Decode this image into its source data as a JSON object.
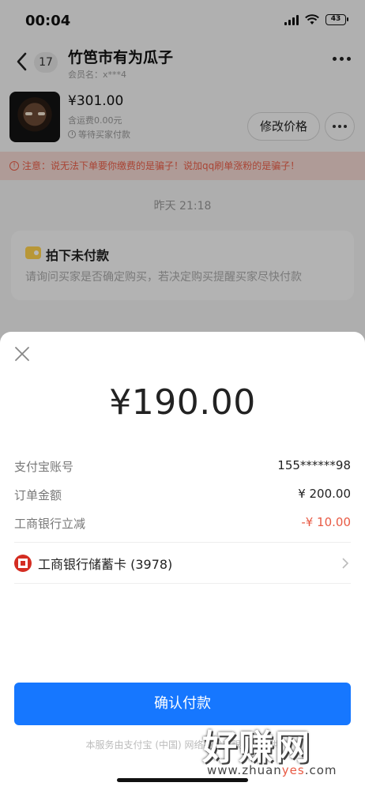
{
  "status_bar": {
    "time": "00:04",
    "battery": "43"
  },
  "nav": {
    "unread_count": "17",
    "shop_title": "竹笆市有为瓜子",
    "member_name": "会员名：x***4"
  },
  "order": {
    "price": "¥301.00",
    "freight": "含运费0.00元",
    "status": "等待买家付款",
    "modify_button": "修改价格"
  },
  "warning": {
    "text": "注意：说无法下单要你缴费的是骗子！说加qq刷单涨粉的是骗子！"
  },
  "chat": {
    "time": "昨天 21:18",
    "card_title": "拍下未付款",
    "card_body": "请询问买家是否确定购买，若决定购买提醒买家尽快付款"
  },
  "payment": {
    "amount": "¥190.00",
    "rows": [
      {
        "label": "支付宝账号",
        "value": "155******98"
      },
      {
        "label": "订单金额",
        "value": "¥ 200.00"
      },
      {
        "label": "工商银行立减",
        "value": "-¥ 10.00"
      }
    ],
    "bank_card": "工商银行储蓄卡 (3978)",
    "confirm_button": "确认付款",
    "footer": "本服务由支付宝 (中国) 网络技术有限公司提供"
  },
  "watermark": {
    "main": "好赚网",
    "sub_a": "www.zhuan",
    "sub_b": "yes",
    "sub_c": ".com"
  },
  "colors": {
    "primary": "#1677ff",
    "warning": "#ea5f49",
    "discount": "#e85a44",
    "bank": "#d42d22"
  }
}
